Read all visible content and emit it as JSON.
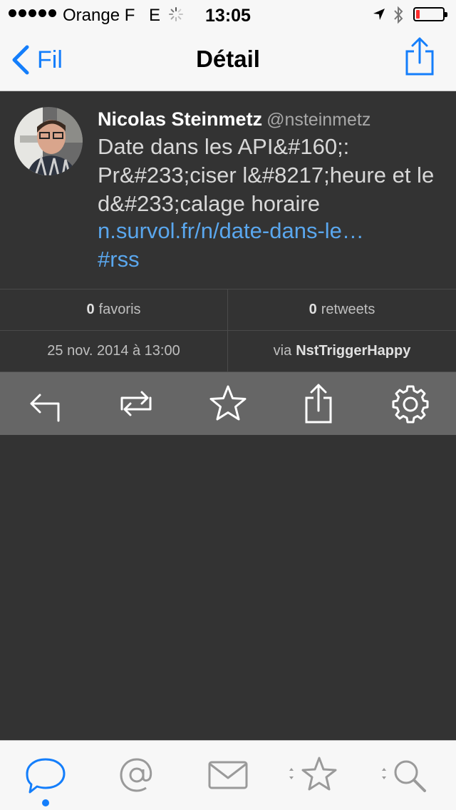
{
  "status_bar": {
    "carrier": "Orange F",
    "network": "E",
    "time": "13:05",
    "battery_level": 0.15
  },
  "nav": {
    "back_label": "Fil",
    "title": "Détail"
  },
  "tweet": {
    "author_name": "Nicolas Steinmetz",
    "author_handle": "@nsteinmetz",
    "text": "Date dans les API&#160;: Pr&#233;ciser l&#8217;heure et le d&#233;calage horaire",
    "link": "n.survol.fr/n/date-dans-le…",
    "hashtag": "#rss"
  },
  "stats": {
    "favorites_count": "0",
    "favorites_label": "favoris",
    "retweets_count": "0",
    "retweets_label": "retweets",
    "date": "25 nov. 2014 à 13:00",
    "via_prefix": "via",
    "via_app": "NstTriggerHappy"
  },
  "actions": [
    "reply-icon",
    "retweet-icon",
    "favorite-star-icon",
    "share-icon",
    "settings-gear-icon"
  ],
  "tabs": [
    "timeline-bubble-icon",
    "mentions-at-icon",
    "messages-envelope-icon",
    "favorites-star-icon",
    "search-magnifier-icon"
  ],
  "colors": {
    "accent": "#147efb",
    "link": "#5aa7ee",
    "background": "#333333",
    "action_bar": "#666666"
  }
}
